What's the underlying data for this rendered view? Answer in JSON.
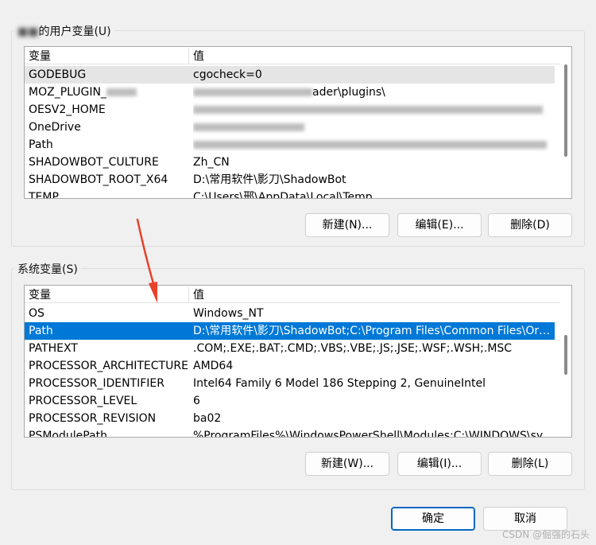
{
  "user_vars": {
    "title": "的用户变量(U)",
    "header": {
      "name": "变量",
      "value": "值"
    },
    "rows": [
      {
        "name": "GODEBUG",
        "value": "cgocheck=0"
      },
      {
        "name": "MOZ_PLUGIN_",
        "value": "ader\\plugins\\"
      },
      {
        "name": "OESV2_HOME",
        "value": ""
      },
      {
        "name": "OneDrive",
        "value": ""
      },
      {
        "name": "Path",
        "value": ""
      },
      {
        "name": "SHADOWBOT_CULTURE",
        "value": "Zh_CN"
      },
      {
        "name": "SHADOWBOT_ROOT_X64",
        "value": "D:\\常用软件\\影刀\\ShadowBot"
      },
      {
        "name": "TEMP",
        "value": "C:\\Users\\邢\\AppData\\Local\\Temp"
      }
    ],
    "buttons": {
      "new": "新建(N)...",
      "edit": "编辑(E)...",
      "delete": "删除(D)"
    }
  },
  "system_vars": {
    "title": "系统变量(S)",
    "header": {
      "name": "变量",
      "value": "值"
    },
    "rows": [
      {
        "name": "OS",
        "value": "Windows_NT"
      },
      {
        "name": "Path",
        "value": "D:\\常用软件\\影刀\\ShadowBot;C:\\Program Files\\Common Files\\Oracl..."
      },
      {
        "name": "PATHEXT",
        "value": ".COM;.EXE;.BAT;.CMD;.VBS;.VBE;.JS;.JSE;.WSF;.WSH;.MSC"
      },
      {
        "name": "PROCESSOR_ARCHITECTURE",
        "value": "AMD64"
      },
      {
        "name": "PROCESSOR_IDENTIFIER",
        "value": "Intel64 Family 6 Model 186 Stepping 2, GenuineIntel"
      },
      {
        "name": "PROCESSOR_LEVEL",
        "value": "6"
      },
      {
        "name": "PROCESSOR_REVISION",
        "value": "ba02"
      },
      {
        "name": "PSModulePath",
        "value": "%ProgramFiles%\\WindowsPowerShell\\Modules;C:\\WINDOWS\\syst..."
      }
    ],
    "buttons": {
      "new": "新建(W)...",
      "edit": "编辑(I)...",
      "delete": "删除(L)"
    }
  },
  "footer": {
    "ok": "确定",
    "cancel": "取消"
  },
  "watermark": "CSDN @倔强的石头",
  "colors": {
    "selection": "#0078d7",
    "annotation_arrow": "#e8412c"
  }
}
